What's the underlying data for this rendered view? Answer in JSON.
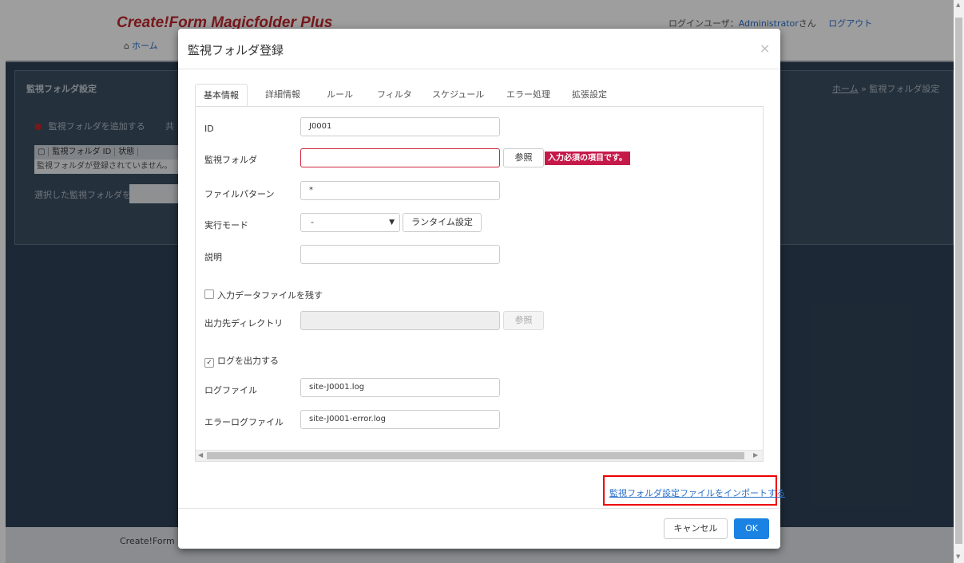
{
  "app": {
    "title": "Create!Form Magicfolder Plus",
    "home_link": "ホーム",
    "login_user_label": "ログインユーザ：",
    "login_user_name": "Administrator",
    "login_user_suffix": "さん",
    "logout": "ログアウト"
  },
  "background_page": {
    "panel_title": "監視フォルダ設定",
    "breadcrumb_home": "ホーム",
    "breadcrumb_sep": "»",
    "breadcrumb_current": "監視フォルダ設定",
    "add_link": "監視フォルダを追加する",
    "share_link_partial": "共",
    "table_headers": [
      "監視フォルダ ID",
      "状態"
    ],
    "table_empty": "監視フォルダが登録されていません。",
    "selected_label": "選択した監視フォルダを",
    "footer_partial": "Create!Form Ma"
  },
  "modal": {
    "title": "監視フォルダ登録",
    "close_symbol": "×",
    "tabs": [
      {
        "label": "基本情報",
        "active": true
      },
      {
        "label": "詳細情報"
      },
      {
        "label": "ルール"
      },
      {
        "label": "フィルタ"
      },
      {
        "label": "スケジュール"
      },
      {
        "label": "エラー処理"
      },
      {
        "label": "拡張設定"
      }
    ],
    "form": {
      "id_label": "ID",
      "id_value": "J0001",
      "folder_label": "監視フォルダ",
      "folder_value": "",
      "browse": "参照",
      "required_error": "入力必須の項目です。",
      "pattern_label": "ファイルパターン",
      "pattern_value": "*",
      "mode_label": "実行モード",
      "mode_value": "-",
      "runtime_button": "ランタイム設定",
      "desc_label": "説明",
      "desc_value": "",
      "keep_input_label": "入力データファイルを残す",
      "keep_input_checked": false,
      "output_dir_label": "出力先ディレクトリ",
      "output_dir_value": "",
      "output_browse": "参照",
      "log_output_label": "ログを出力する",
      "log_output_checked": true,
      "log_file_label": "ログファイル",
      "log_file_value": "site-J0001.log",
      "error_log_label": "エラーログファイル",
      "error_log_value": "site-J0001-error.log"
    },
    "import_link": "監視フォルダ設定ファイルをインポートする",
    "cancel": "キャンセル",
    "ok": "OK"
  },
  "colors": {
    "brand_red": "#c1272d",
    "error_badge": "#c5194a",
    "link_blue": "#2a6fc9",
    "primary_button": "#1a82e2",
    "dark_background": "#2e4256"
  }
}
